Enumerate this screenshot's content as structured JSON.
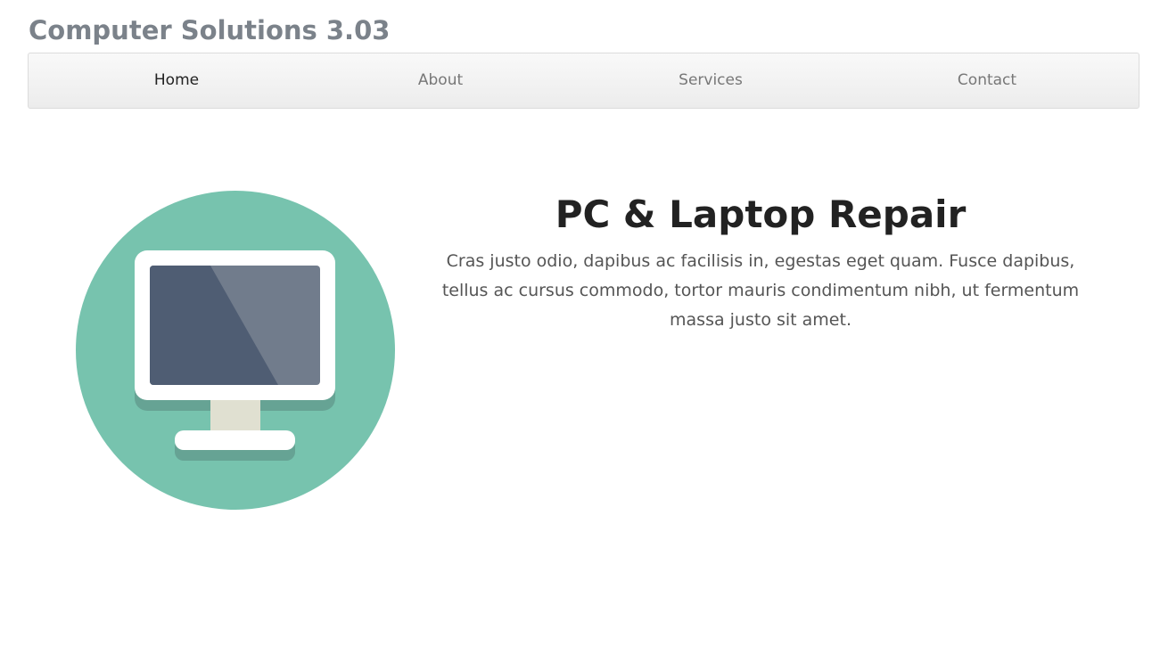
{
  "header": {
    "title": "Computer Solutions 3.03"
  },
  "nav": {
    "items": [
      {
        "label": "Home",
        "active": true
      },
      {
        "label": "About",
        "active": false
      },
      {
        "label": "Services",
        "active": false
      },
      {
        "label": "Contact",
        "active": false
      }
    ]
  },
  "hero": {
    "heading": "PC & Laptop Repair",
    "body": "Cras justo odio, dapibus ac facilisis in, egestas eget quam. Fusce dapibus, tellus ac cursus commodo, tortor mauris condimentum nibh, ut fermentum massa justo sit amet.",
    "icon": "desktop-monitor-icon"
  },
  "colors": {
    "circle": "#77c3ae",
    "screen_dark": "#4f5d73",
    "screen_light": "#717c8c",
    "bezel": "#ffffff",
    "stand": "#e0e0d1",
    "shadow": "#66a394"
  }
}
